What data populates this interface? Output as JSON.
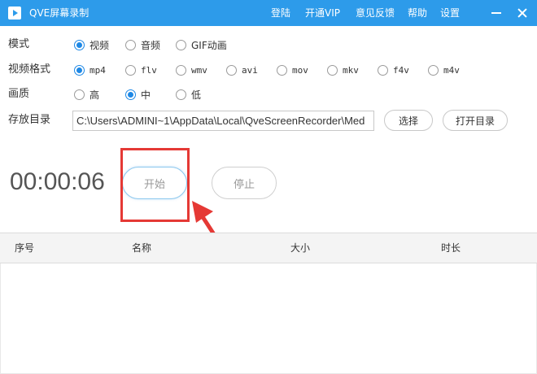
{
  "app": {
    "title": "QVE屏幕录制",
    "menu": [
      "登陆",
      "开通VIP",
      "意见反馈",
      "帮助",
      "设置"
    ]
  },
  "mode": {
    "label": "模式",
    "options": [
      "视频",
      "音频",
      "GIF动画"
    ],
    "selected": "视频"
  },
  "format": {
    "label": "视频格式",
    "options": [
      "mp4",
      "flv",
      "wmv",
      "avi",
      "mov",
      "mkv",
      "f4v",
      "m4v"
    ],
    "selected": "mp4"
  },
  "quality": {
    "label": "画质",
    "options": [
      "高",
      "中",
      "低"
    ],
    "selected": "中"
  },
  "storage": {
    "label": "存放目录",
    "path": "C:\\Users\\ADMINI~1\\AppData\\Local\\QveScreenRecorder\\Med",
    "choose_label": "选择",
    "open_label": "打开目录"
  },
  "recorder": {
    "timer": "00:00:06",
    "start_label": "开始",
    "stop_label": "停止"
  },
  "table": {
    "columns": [
      "序号",
      "名称",
      "大小",
      "时长"
    ],
    "rows": []
  },
  "colors": {
    "titlebar": "#2d9bea",
    "accent": "#1e88e5",
    "annotation": "#e53935"
  }
}
